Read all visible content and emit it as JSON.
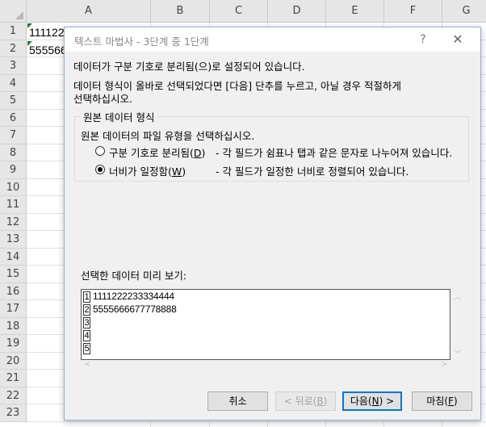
{
  "sheet": {
    "columns": [
      "A",
      "B",
      "C",
      "D",
      "E",
      "F",
      "G"
    ],
    "rows": [
      "1",
      "2",
      "3",
      "4",
      "5",
      "6",
      "7",
      "8",
      "9",
      "10",
      "11",
      "12",
      "13",
      "14",
      "15",
      "16",
      "17",
      "18",
      "19",
      "20",
      "21",
      "22",
      "23"
    ],
    "cells": {
      "a1": "111122",
      "a2": "555566"
    }
  },
  "dialog": {
    "title": "텍스트 마법사 - 3단계 중 1단계",
    "help_label": "?",
    "close_label": "✕",
    "intro_line1": "데이터가 구분 기호로 분리됨(으)로 설정되어 있습니다.",
    "intro_line2": "데이터 형식이 올바로 선택되었다면 [다음] 단추를 누르고, 아닐 경우 적절하게",
    "intro_line3": "선택하십시오.",
    "group_title": "원본 데이터 형식",
    "group_prompt": "원본 데이터의 파일 유형을 선택하십시오.",
    "option_delimited": {
      "label_pre": "구분 기호로 분리됨(",
      "key": "D",
      "label_post": ")",
      "desc": "- 각 필드가 쉼표나 탭과 같은 문자로 나누어져 있습니다.",
      "selected": false
    },
    "option_fixed": {
      "label_pre": "너비가 일정함(",
      "key": "W",
      "label_post": ")",
      "desc": "- 각 필드가 일정한 너비로 정렬되어 있습니다.",
      "selected": true
    },
    "preview_label": "선택한 데이터 미리 보기:",
    "preview_lines": [
      {
        "num": "1",
        "text": "1111222233334444"
      },
      {
        "num": "2",
        "text": "5555666677778888"
      },
      {
        "num": "3",
        "text": ""
      },
      {
        "num": "4",
        "text": ""
      },
      {
        "num": "5",
        "text": ""
      }
    ],
    "buttons": {
      "cancel": "취소",
      "back_pre": "< 뒤로(",
      "back_key": "B",
      "back_post": ")",
      "next_pre": "다음(",
      "next_key": "N",
      "next_post": ") >",
      "finish_pre": "마침(",
      "finish_key": "F",
      "finish_post": ")"
    }
  }
}
